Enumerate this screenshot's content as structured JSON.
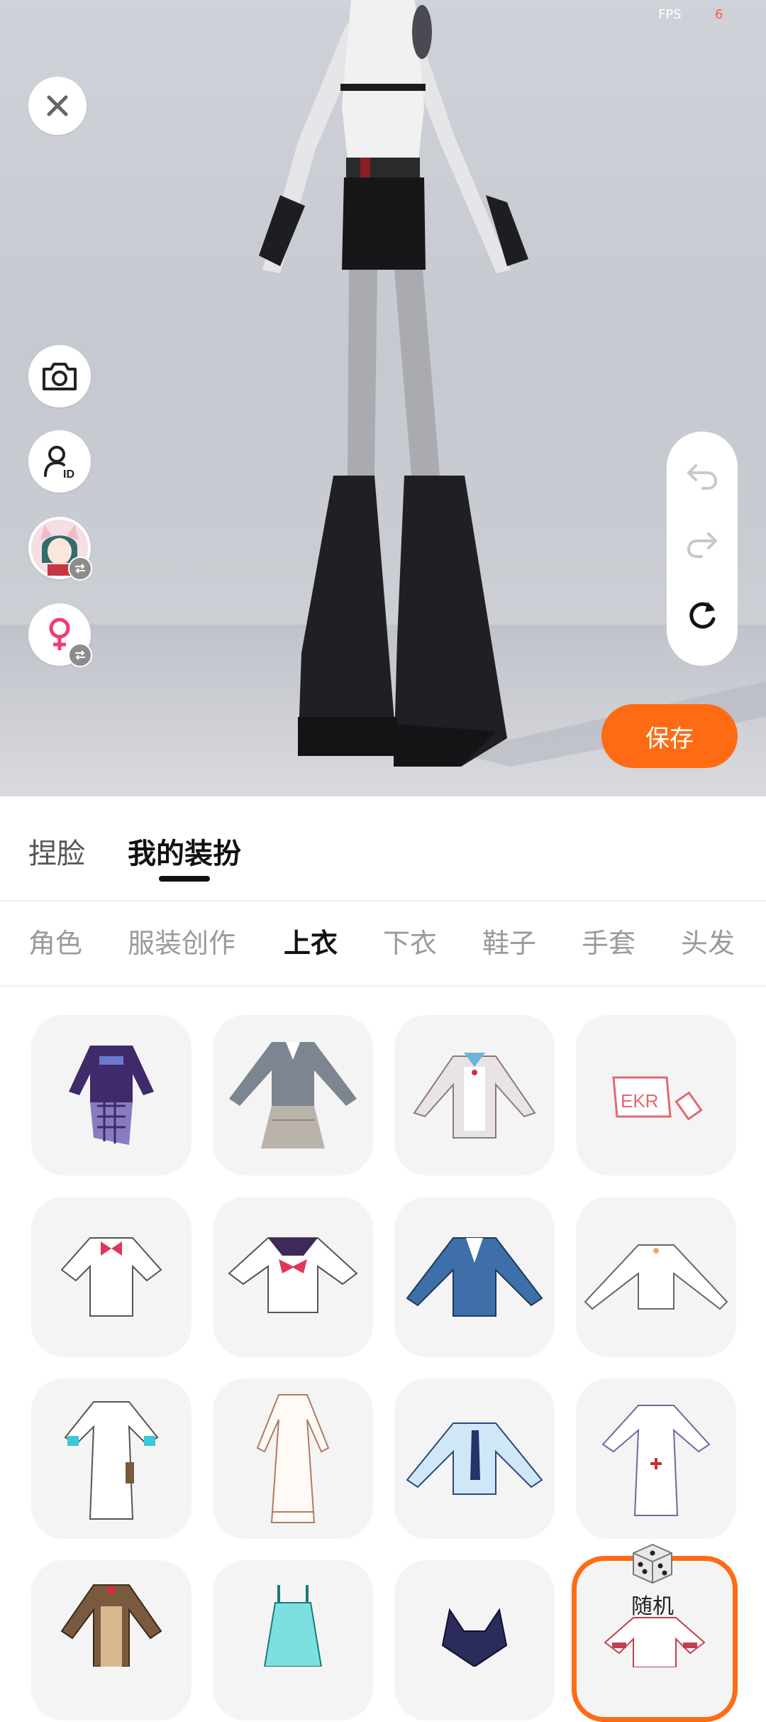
{
  "status": {
    "fps_label": "FPS",
    "fps_value": "6"
  },
  "viewport": {
    "close_icon": "close-icon",
    "left_buttons": [
      "camera-icon",
      "user-id-icon",
      "avatar-thumbnail",
      "female-gender-icon"
    ],
    "history": [
      "undo-icon",
      "redo-icon",
      "reset-icon"
    ],
    "save_label": "保存"
  },
  "tabs": {
    "face": "捏脸",
    "outfit": "我的装扮"
  },
  "categories": [
    "角色",
    "服装创作",
    "上衣",
    "下衣",
    "鞋子",
    "手套",
    "头发"
  ],
  "random_label": "随机",
  "colors": {
    "accent": "#ff6b14"
  }
}
